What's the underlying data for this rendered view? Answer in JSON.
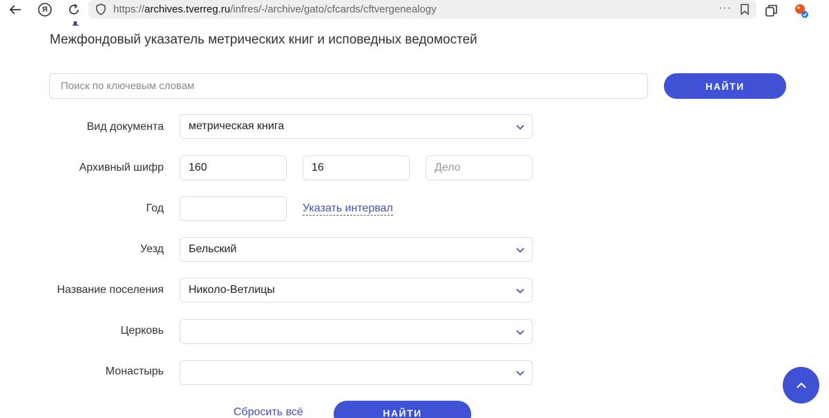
{
  "browser": {
    "url_prefix": "https://",
    "url_domain": "archives.tverreg.ru",
    "url_path": "/infres/-/archive/gato/cfcards/cftvergenealogy",
    "menu_dots": "···",
    "yandex_label": "Я"
  },
  "page": {
    "partial_heading": "Р",
    "subtitle": "Межфондовый указатель метрических книг и исповедных ведомостей"
  },
  "search": {
    "placeholder": "Поиск по ключевым словам",
    "value": "",
    "button_label": "НАЙТИ"
  },
  "form": {
    "doc_type": {
      "label": "Вид документа",
      "value": "метрическая книга"
    },
    "archive_code": {
      "label": "Архивный шифр",
      "fond": "160",
      "opis": "16",
      "delo_placeholder": "Дело"
    },
    "year": {
      "label": "Год",
      "value": "",
      "interval_link": "Указать интервал"
    },
    "uezd": {
      "label": "Уезд",
      "value": "Бельский"
    },
    "settlement": {
      "label": "Название поселения",
      "value": "Николо-Ветлицы"
    },
    "church": {
      "label": "Церковь",
      "value": ""
    },
    "monastery": {
      "label": "Монастырь",
      "value": ""
    },
    "reset_label": "Сбросить всё",
    "submit_label": "НАЙТИ"
  },
  "colors": {
    "accent": "#3f51d4",
    "link": "#3f51b5"
  }
}
